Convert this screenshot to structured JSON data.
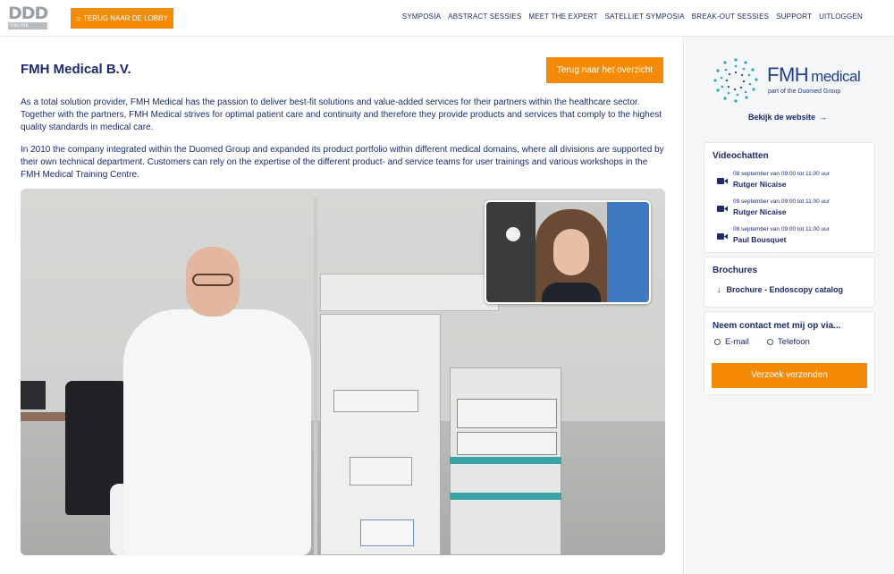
{
  "header": {
    "logo_text": "DDD",
    "logo_subtext": "ONLINE",
    "lobby_button": "TERUG NAAR DE LOBBY",
    "lobby_icon": "home-icon",
    "nav": [
      "SYMPOSIA",
      "ABSTRACT SESSIES",
      "MEET THE EXPERT",
      "SATELLIET SYMPOSIA",
      "BREAK-OUT SESSIES",
      "SUPPORT",
      "UITLOGGEN"
    ]
  },
  "main": {
    "title": "FMH Medical B.V.",
    "overview_button": "Terug naar het overzicht",
    "paragraphs": [
      "As a total solution provider, FMH Medical has the passion to deliver best-fit solutions and value-added services for their partners within the healthcare sector. Together with the partners, FMH Medical strives for optimal patient care and continuity and therefore they provide products and services that comply to the highest quality standards in medical care.",
      "In 2010 the company integrated within the Duomed Group and expanded its product portfolio within different medical domains, where all divisions are supported by their own technical department. Customers can rely on the expertise of the different product- and service teams for user trainings and various workshops in the FMH Medical Training Centre."
    ]
  },
  "sidebar": {
    "brand_name": "FMH",
    "brand_name_suffix": "medical",
    "brand_tagline": "part of the Duomed Group",
    "website_link": "Bekijk de website",
    "videochat": {
      "title": "Videochatten",
      "slots": [
        {
          "date": "08 september van 09:00 tot 11:00 uur",
          "name": "Rutger Nicaise"
        },
        {
          "date": "09 september van 09:00 tot 11:00 uur",
          "name": "Rutger Nicaise"
        },
        {
          "date": "08 september van 09:00 tot 11:00 uur",
          "name": "Paul Bousquet"
        }
      ]
    },
    "brochures": {
      "title": "Brochures",
      "items": [
        "Brochure - Endoscopy catalog"
      ]
    },
    "contact": {
      "title": "Neem contact met mij op via...",
      "options": [
        "E-mail",
        "Telefoon"
      ],
      "submit": "Verzoek verzenden"
    }
  },
  "colors": {
    "accent": "#f58a06",
    "text": "#1d2a6b",
    "brand": "#1d3f8f",
    "sidebar_bg": "#f5f6f8"
  }
}
